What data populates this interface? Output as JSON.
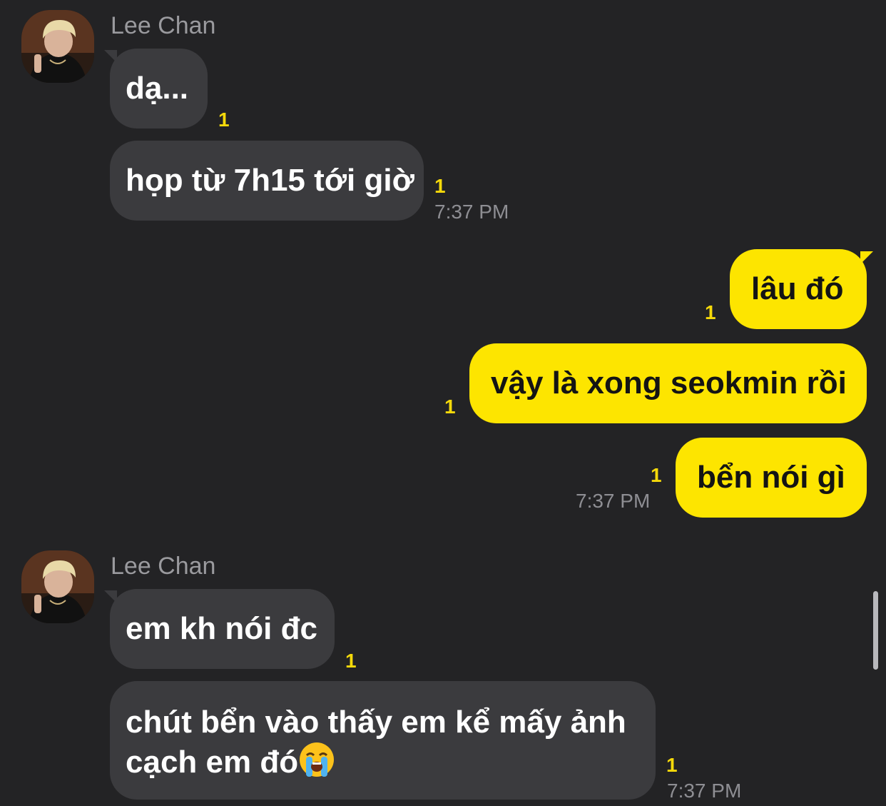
{
  "groups": [
    {
      "sender": "Lee Chan",
      "messages": [
        {
          "text": "dạ...",
          "unread": "1",
          "time": ""
        },
        {
          "text": "họp từ 7h15 tới giờ",
          "unread": "1",
          "time": "7:37 PM"
        }
      ]
    },
    {
      "sender": "me",
      "messages": [
        {
          "text": "lâu đó",
          "unread": "1",
          "time": ""
        },
        {
          "text": "vậy là xong seokmin rồi",
          "unread": "1",
          "time": ""
        },
        {
          "text": "bển nói gì",
          "unread": "1",
          "time": "7:37 PM"
        }
      ]
    },
    {
      "sender": "Lee Chan",
      "messages": [
        {
          "text": "em kh nói đc",
          "unread": "1",
          "time": ""
        },
        {
          "text_line1": "chút bển vào thấy em kể mấy ảnh",
          "text_line2": "cạch em đó",
          "emoji": "loudly-crying-face-emoji",
          "unread": "1",
          "time": "7:37 PM"
        }
      ]
    }
  ],
  "colors": {
    "background": "#232325",
    "incoming_bubble": "#3b3b3e",
    "outgoing_bubble": "#fde500",
    "unread_count": "#f5d90a",
    "timestamp": "#8e8e93"
  }
}
